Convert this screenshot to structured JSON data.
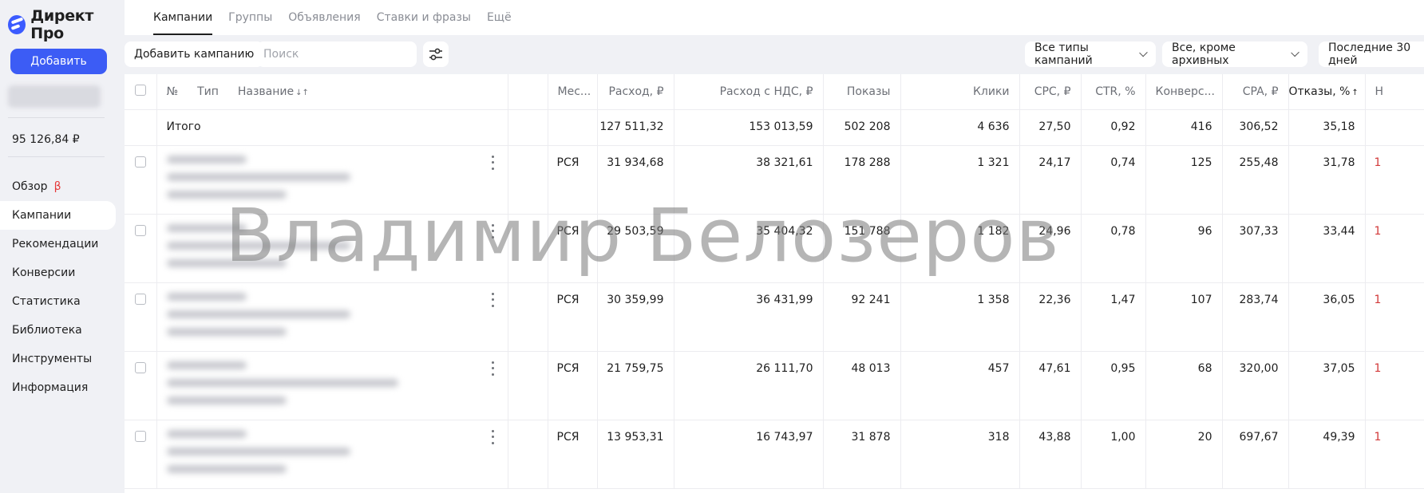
{
  "app": {
    "logo_text": "Директ Про"
  },
  "sidebar": {
    "add_button": "Добавить",
    "balance": "95 126,84 ₽",
    "items": [
      {
        "label": "Обзор",
        "badge": "β"
      },
      {
        "label": "Кампании"
      },
      {
        "label": "Рекомендации"
      },
      {
        "label": "Конверсии"
      },
      {
        "label": "Статистика"
      },
      {
        "label": "Библиотека"
      },
      {
        "label": "Инструменты"
      },
      {
        "label": "Информация"
      }
    ]
  },
  "tabs": [
    "Кампании",
    "Группы",
    "Объявления",
    "Ставки и фразы",
    "Ещё"
  ],
  "toolbar": {
    "add_campaign": "Добавить кампанию",
    "search_placeholder": "Поиск",
    "campaign_types": "Все типы кампаний",
    "status_filter": "Все, кроме архивных",
    "period": "Последние 30 дней"
  },
  "table": {
    "headers": {
      "num": "№",
      "type": "Тип",
      "name": "Название",
      "place": "Мес...",
      "cost": "Расход, ₽",
      "cost_vat": "Расход с НДС, ₽",
      "shows": "Показы",
      "clicks": "Клики",
      "cpc": "CPC, ₽",
      "ctr": "CTR, %",
      "conv": "Конверс...",
      "cpa": "CPA, ₽",
      "bounce": "Отказы, %",
      "next": "Н"
    },
    "total": {
      "label": "Итого",
      "cost": "127 511,32",
      "cost_vat": "153 013,59",
      "shows": "502 208",
      "clicks": "4 636",
      "cpc": "27,50",
      "ctr": "0,92",
      "conv": "416",
      "cpa": "306,52",
      "bounce": "35,18"
    },
    "rows": [
      {
        "place": "РСЯ",
        "cost": "31 934,68",
        "cost_vat": "38 321,61",
        "shows": "178 288",
        "clicks": "1 321",
        "cpc": "24,17",
        "ctr": "0,74",
        "conv": "125",
        "cpa": "255,48",
        "bounce": "31,78",
        "next": "1"
      },
      {
        "place": "РСЯ",
        "cost": "29 503,59",
        "cost_vat": "35 404,32",
        "shows": "151 788",
        "clicks": "1 182",
        "cpc": "24,96",
        "ctr": "0,78",
        "conv": "96",
        "cpa": "307,33",
        "bounce": "33,44",
        "next": "1"
      },
      {
        "place": "РСЯ",
        "cost": "30 359,99",
        "cost_vat": "36 431,99",
        "shows": "92 241",
        "clicks": "1 358",
        "cpc": "22,36",
        "ctr": "1,47",
        "conv": "107",
        "cpa": "283,74",
        "bounce": "36,05",
        "next": "1"
      },
      {
        "place": "РСЯ",
        "cost": "21 759,75",
        "cost_vat": "26 111,70",
        "shows": "48 013",
        "clicks": "457",
        "cpc": "47,61",
        "ctr": "0,95",
        "conv": "68",
        "cpa": "320,00",
        "bounce": "37,05",
        "next": "1"
      },
      {
        "place": "РСЯ",
        "cost": "13 953,31",
        "cost_vat": "16 743,97",
        "shows": "31 878",
        "clicks": "318",
        "cpc": "43,88",
        "ctr": "1,00",
        "conv": "20",
        "cpa": "697,67",
        "bounce": "49,39",
        "next": "1"
      }
    ]
  },
  "watermark": "Владимир Белозеров"
}
